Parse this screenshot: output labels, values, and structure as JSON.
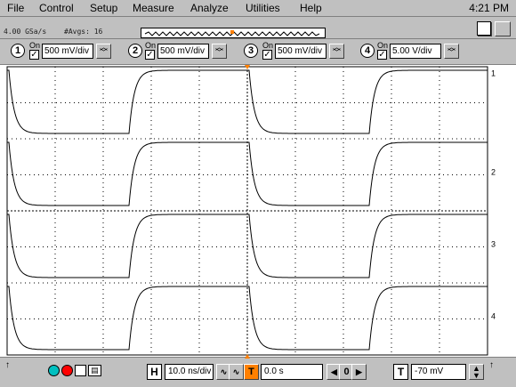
{
  "menu": {
    "items": [
      {
        "label": "File"
      },
      {
        "label": "Control"
      },
      {
        "label": "Setup"
      },
      {
        "label": "Measure"
      },
      {
        "label": "Analyze"
      },
      {
        "label": "Utilities"
      },
      {
        "label": "Help"
      }
    ],
    "clock": "4:21 PM"
  },
  "acquisition": {
    "rate_text": "4.00 GSa/s",
    "averages_text": "#Avgs: 16"
  },
  "channels": [
    {
      "number": "1",
      "on_label": "On",
      "checked": true,
      "scale": "500 mV/div",
      "trace_color": "#000000"
    },
    {
      "number": "2",
      "on_label": "On",
      "checked": true,
      "scale": "500 mV/div",
      "trace_color": "#000000"
    },
    {
      "number": "3",
      "on_label": "On",
      "checked": true,
      "scale": "500 mV/div",
      "trace_color": "#000000"
    },
    {
      "number": "4",
      "on_label": "On",
      "checked": true,
      "scale": "5.00 V/div",
      "trace_color": "#000000"
    }
  ],
  "horizontal": {
    "label": "H",
    "timebase": "10.0 ns/div",
    "position_label": "T",
    "position": "0.0 s",
    "nav_value": "0"
  },
  "trigger": {
    "label": "T",
    "level": "-70 mV"
  },
  "colors": {
    "background": "#c0c0c0",
    "screen": "#ffffff",
    "trace": "#000000",
    "trigger_marker": "#ff8000",
    "run_button": "#00c0c0",
    "stop_button": "#ff0000"
  },
  "icons": {
    "run": "run-icon",
    "stop": "stop-icon",
    "single": "single-icon",
    "print": "print-icon"
  }
}
